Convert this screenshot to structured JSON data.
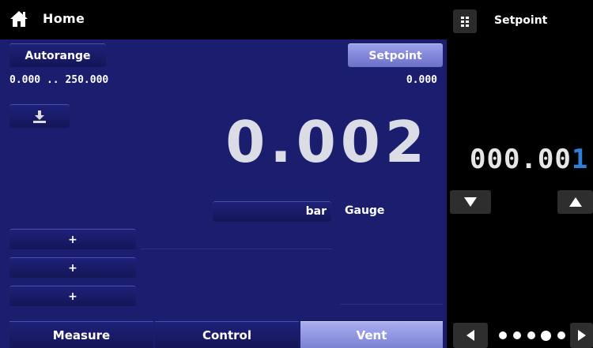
{
  "header": {
    "title": "Home",
    "icon": "home-icon"
  },
  "main": {
    "autorange_label": "Autorange",
    "setpoint_label": "Setpoint",
    "range": "0.000 .. 250.000",
    "setpoint_value": "0.000",
    "reading": "0.002",
    "unit": "bar",
    "mode": "Gauge",
    "plus_labels": [
      "+",
      "+",
      "+"
    ]
  },
  "tabs": [
    {
      "label": "Measure",
      "active": false
    },
    {
      "label": "Control",
      "active": false
    },
    {
      "label": "Vent",
      "active": true
    }
  ],
  "setpoint_panel": {
    "title": "Setpoint",
    "value_prefix": "000.00",
    "value_cursor_digit": "1",
    "page_dots": 5
  },
  "colors": {
    "main_bg": "#1b1d6e",
    "active_button": "#7c82d4",
    "cursor_digit": "#2f7fd8"
  }
}
